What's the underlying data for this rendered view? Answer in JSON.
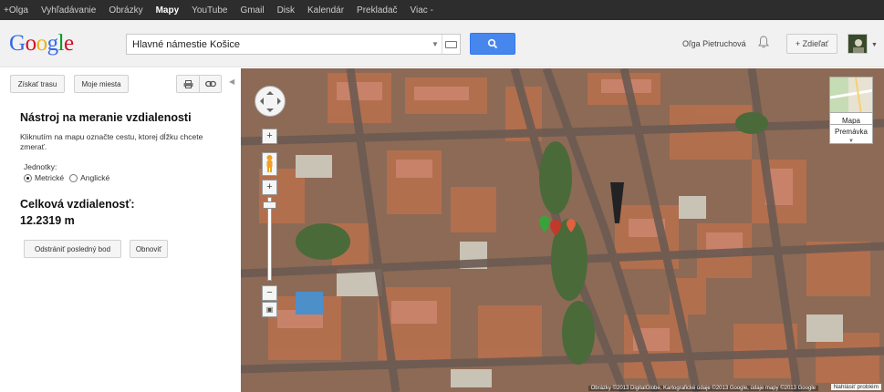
{
  "topbar": {
    "items": [
      "+Olga",
      "Vyhľadávanie",
      "Obrázky",
      "Mapy",
      "YouTube",
      "Gmail",
      "Disk",
      "Kalendár",
      "Prekladač",
      "Viac -"
    ],
    "active_index": 3
  },
  "header": {
    "logo": "Google",
    "search_value": "Hlavné námestie Košice",
    "user_name": "Oľga Pietruchová",
    "share_label": "+ Zdieľať"
  },
  "panel": {
    "route_button": "Získať trasu",
    "my_places_button": "Moje miesta",
    "title": "Nástroj na meranie vzdialenosti",
    "description": "Kliknutím na mapu označte cestu, ktorej dĺžku chcete zmerať.",
    "units_label": "Jednotky:",
    "unit_metric": "Metrické",
    "unit_english": "Anglické",
    "selected_unit": "metric",
    "total_label": "Celková vzdialenosť:",
    "total_value": "12.2319 m",
    "remove_last_button": "Odstrániť posledný bod",
    "reset_button": "Obnoviť"
  },
  "map": {
    "map_type_label": "Mapa",
    "traffic_label": "Premávka",
    "copyright": "Obrázky ©2013 DigitalGlobe, Kartografické údaje ©2013 Google, údaje mapy ©2013 Google",
    "report_label": "Nahlásiť problém"
  },
  "colors": {
    "logo": [
      "#3369e8",
      "#d50f25",
      "#eeb211",
      "#3369e8",
      "#009925",
      "#d50f25"
    ],
    "search_button": "#4787ed"
  }
}
